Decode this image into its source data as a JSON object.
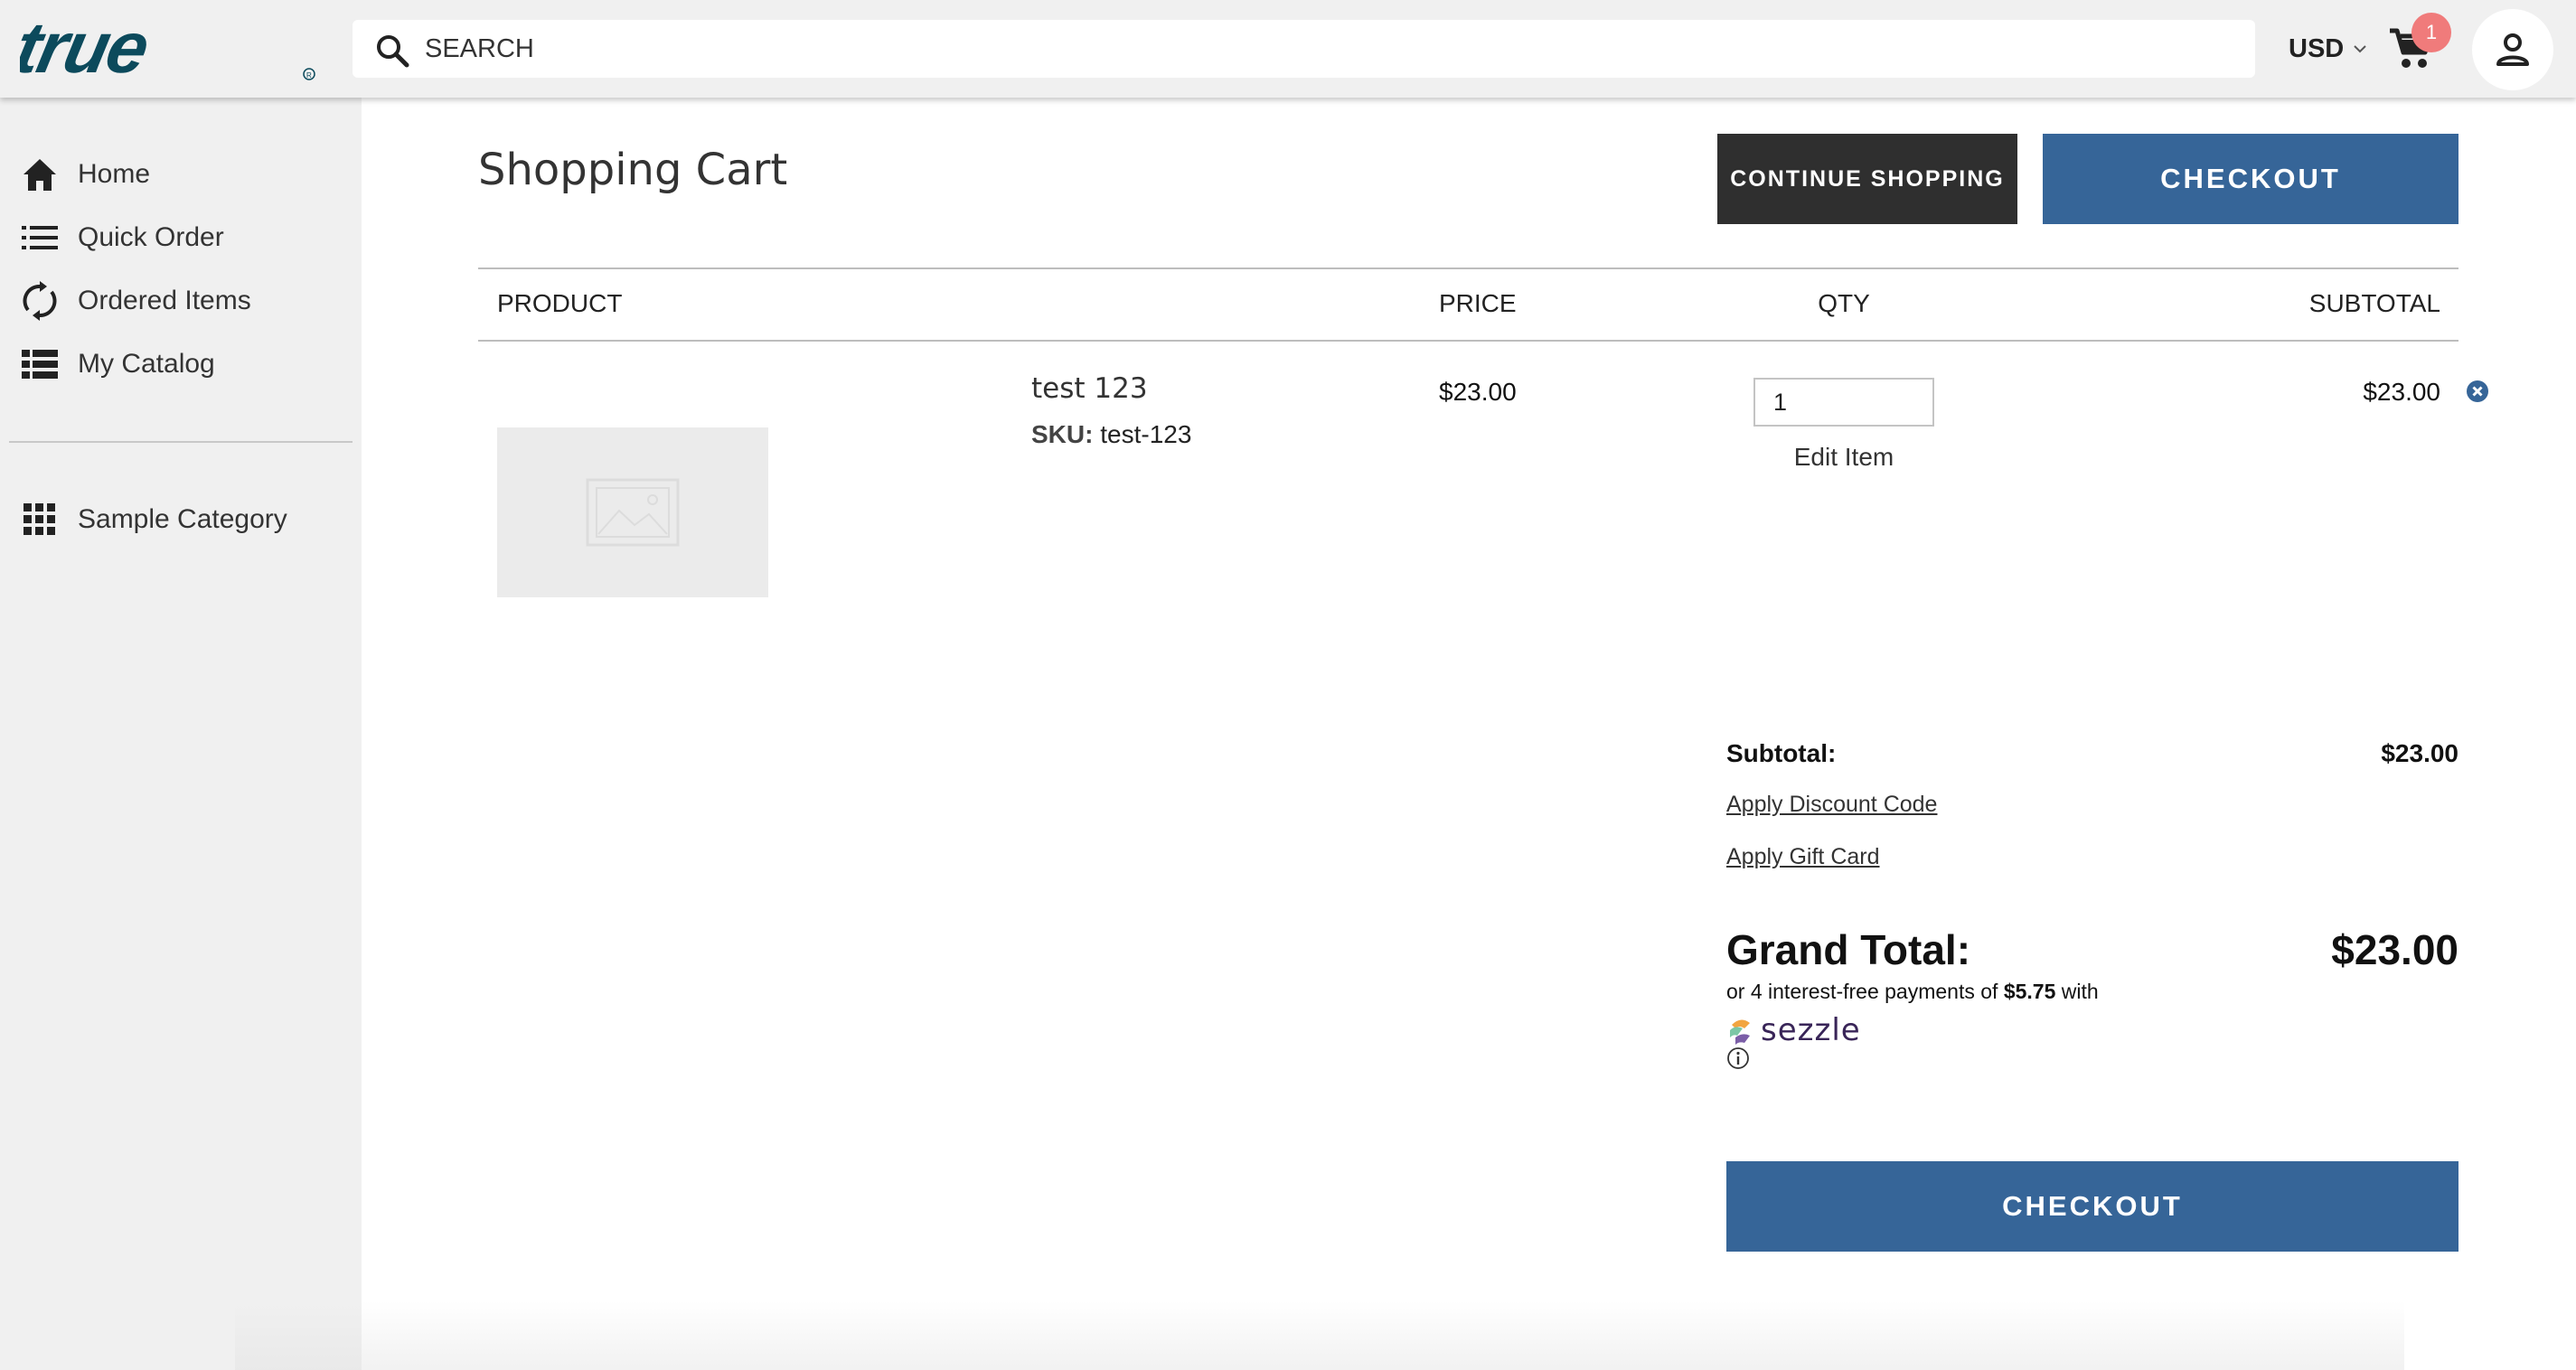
{
  "brand": {
    "logo_text": "true",
    "icon": "true-logo",
    "color": "#0c4a5c"
  },
  "header": {
    "search": {
      "placeholder": "SEARCH",
      "icon": "search-icon"
    },
    "currency": "USD",
    "cart": {
      "icon": "cart-icon",
      "count": "1",
      "badge_color": "#f07b7b"
    },
    "account_icon": "user-icon"
  },
  "sidebar": {
    "items": [
      {
        "label": "Home",
        "icon": "home-icon"
      },
      {
        "label": "Quick Order",
        "icon": "list-icon"
      },
      {
        "label": "Ordered Items",
        "icon": "refresh-icon"
      },
      {
        "label": "My Catalog",
        "icon": "catalog-icon"
      }
    ],
    "categories": [
      {
        "label": "Sample Category",
        "icon": "grid-icon"
      }
    ]
  },
  "page": {
    "title": "Shopping Cart",
    "continue_label": "CONTINUE SHOPPING",
    "checkout_label": "CHECKOUT"
  },
  "table": {
    "headers": {
      "product": "PRODUCT",
      "price": "PRICE",
      "qty": "QTY",
      "subtotal": "SUBTOTAL"
    },
    "rows": [
      {
        "name": "test 123",
        "sku_label": "SKU:",
        "sku": "test-123",
        "price": "$23.00",
        "qty": "1",
        "edit_label": "Edit Item",
        "subtotal": "$23.00"
      }
    ]
  },
  "summary": {
    "subtotal_label": "Subtotal:",
    "subtotal_value": "$23.00",
    "discount_link": "Apply Discount Code",
    "gift_card_link": "Apply Gift Card",
    "grand_total_label": "Grand Total:",
    "grand_total_value": "$23.00",
    "sezzle_prefix": "or 4 interest-free payments of",
    "sezzle_amount": "$5.75",
    "sezzle_suffix": "with",
    "sezzle_brand": "sezzle",
    "checkout_label": "CHECKOUT"
  },
  "colors": {
    "accent": "#366598",
    "dark_button": "#2f2f2f",
    "sidebar_bg": "#f0f0f0"
  }
}
